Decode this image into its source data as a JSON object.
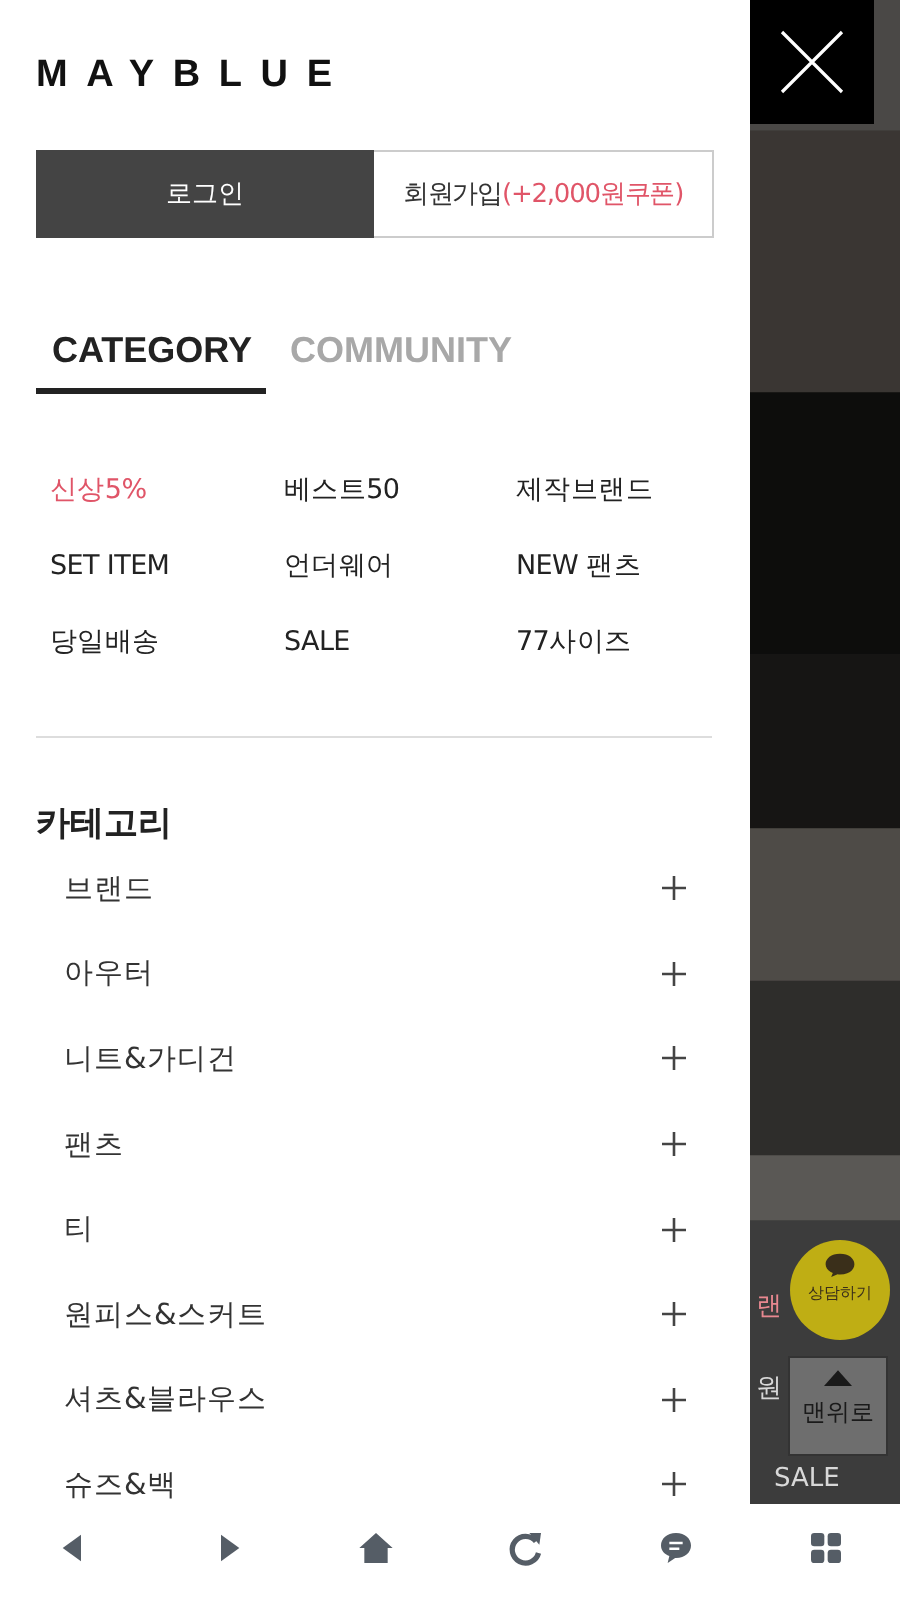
{
  "drawer": {
    "logo": "MAYBLUE",
    "auth_buttons": [
      {
        "kind": "primary",
        "label": "로그인"
      },
      {
        "kind": "secondary",
        "label": "회원가입",
        "note": "(+2,000원쿠폰)"
      }
    ],
    "tabs": [
      {
        "label": "CATEGORY",
        "selected": true
      },
      {
        "label": "COMMUNITY",
        "selected": false
      }
    ],
    "quick_links": [
      {
        "label": "신상5%",
        "highlighted": true
      },
      {
        "label": "베스트50",
        "highlighted": false
      },
      {
        "label": "제작브랜드",
        "highlighted": false
      },
      {
        "label": "SET ITEM",
        "highlighted": false
      },
      {
        "label": "언더웨어",
        "highlighted": false
      },
      {
        "label": "NEW 팬츠",
        "highlighted": false
      },
      {
        "label": "당일배송",
        "highlighted": false
      },
      {
        "label": "SALE",
        "highlighted": false
      },
      {
        "label": "77사이즈",
        "highlighted": false
      }
    ],
    "category": {
      "title": "카테고리",
      "items": [
        {
          "label": "브랜드",
          "expanded": false
        },
        {
          "label": "아우터",
          "expanded": false
        },
        {
          "label": "니트&가디건",
          "expanded": false
        },
        {
          "label": "팬츠",
          "expanded": false
        },
        {
          "label": "티",
          "expanded": false
        },
        {
          "label": "원피스&스커트",
          "expanded": false
        },
        {
          "label": "셔츠&블라우스",
          "expanded": false
        },
        {
          "label": "슈즈&백",
          "expanded": false
        }
      ]
    }
  },
  "background_page": {
    "fragments": [
      {
        "kind": "link",
        "text": "랜"
      },
      {
        "kind": "plain",
        "text": "원"
      },
      {
        "kind": "plain",
        "text": "SALE"
      }
    ],
    "chat_button": {
      "label": "상담하기"
    },
    "top_button": {
      "label": "맨위로"
    }
  },
  "bottom_nav": [
    {
      "kind": "back"
    },
    {
      "kind": "forward"
    },
    {
      "kind": "home"
    },
    {
      "kind": "refresh"
    },
    {
      "kind": "chat"
    },
    {
      "kind": "grid"
    }
  ]
}
